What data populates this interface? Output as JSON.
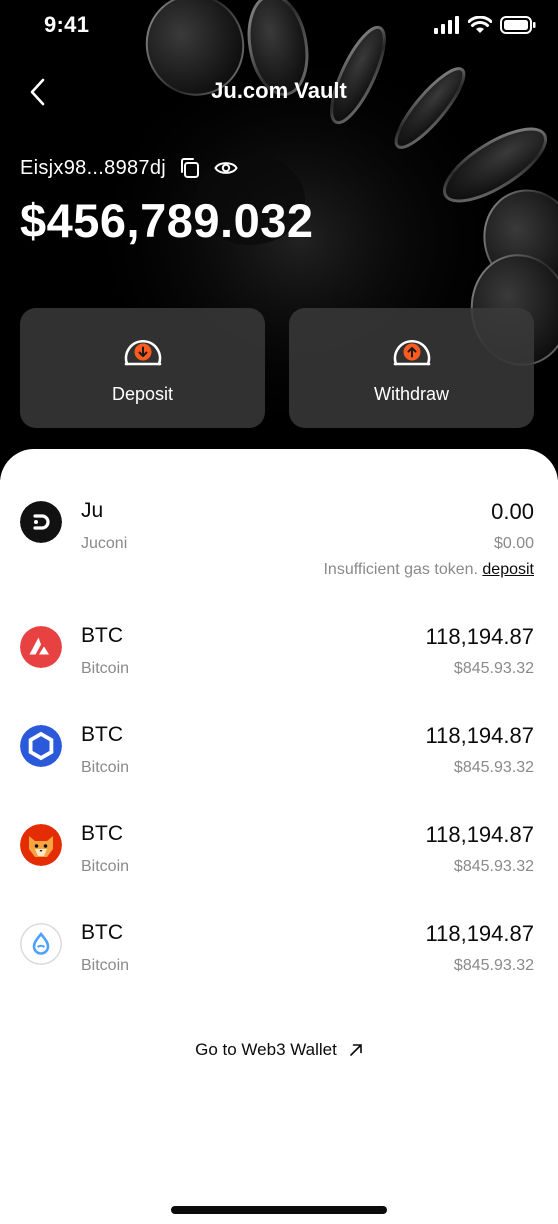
{
  "status_bar": {
    "time": "9:41",
    "icons": [
      "signal-icon",
      "wifi-icon",
      "battery-icon"
    ]
  },
  "header": {
    "title": "Ju.com Vault",
    "back_icon": "chevron-left-icon"
  },
  "wallet": {
    "address": "Eisjx98...8987dj",
    "balance": "$456,789.032",
    "copy_icon": "copy-icon",
    "visibility_icon": "eye-icon"
  },
  "actions": {
    "deposit_label": "Deposit",
    "withdraw_label": "Withdraw",
    "accent_color": "#ff5a1f"
  },
  "assets": [
    {
      "symbol": "Ju",
      "name": "Juconi",
      "amount": "0.00",
      "value": "$0.00",
      "icon": "juconi-icon",
      "note": "Insufficient gas token.",
      "note_link": "deposit"
    },
    {
      "symbol": "BTC",
      "name": "Bitcoin",
      "amount": "118,194.87",
      "value": "$845.93.32",
      "icon": "avalanche-icon"
    },
    {
      "symbol": "BTC",
      "name": "Bitcoin",
      "amount": "118,194.87",
      "value": "$845.93.32",
      "icon": "chainlink-icon"
    },
    {
      "symbol": "BTC",
      "name": "Bitcoin",
      "amount": "118,194.87",
      "value": "$845.93.32",
      "icon": "shiba-icon"
    },
    {
      "symbol": "BTC",
      "name": "Bitcoin",
      "amount": "118,194.87",
      "value": "$845.93.32",
      "icon": "sui-icon"
    }
  ],
  "footer": {
    "web3_link": "Go to Web3 Wallet",
    "link_icon": "arrow-up-right-icon"
  }
}
